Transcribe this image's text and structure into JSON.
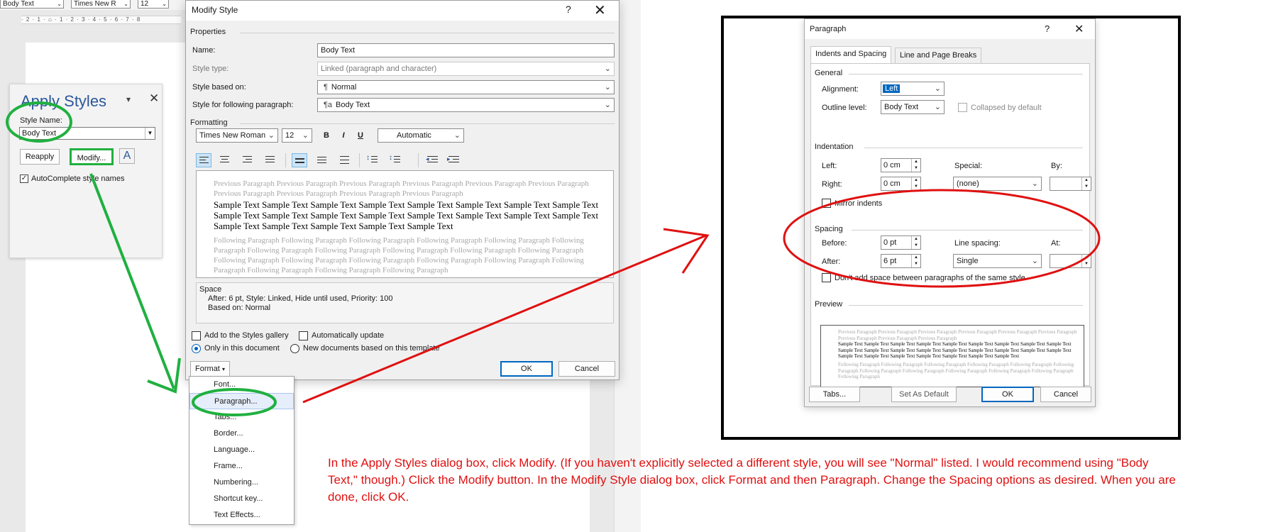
{
  "word": {
    "toolbar": {
      "style_box": "Body Text",
      "font_box": "Times New R",
      "size_box": "12"
    },
    "ruler": "· 2 · 1 · ⌂ · 1 · 2 · 3 · 4 · 5 · 6 · 7 · 8"
  },
  "apply_styles": {
    "title": "Apply Styles",
    "style_name_label": "Style Name:",
    "style_name_value": "Body Text",
    "reapply": "Reapply",
    "modify": "Modify...",
    "styles_icon_glyph": "A",
    "autocomplete_label": "AutoComplete style names",
    "autocomplete_checked": true
  },
  "modify_style": {
    "title": "Modify Style",
    "help": "?",
    "close": "✕",
    "properties_heading": "Properties",
    "name_label": "Name:",
    "name_value": "Body Text",
    "style_type_label": "Style type:",
    "style_type_value": "Linked (paragraph and character)",
    "based_on_label": "Style based on:",
    "based_on_value": "Normal",
    "based_on_glyph": "¶",
    "following_label": "Style for following paragraph:",
    "following_value": "Body Text",
    "following_glyph": "¶a",
    "formatting_heading": "Formatting",
    "font_value": "Times New Roman",
    "size_value": "12",
    "bold": "B",
    "italic": "I",
    "underline": "U",
    "color_value": "Automatic",
    "preview": {
      "previous": "Previous Paragraph Previous Paragraph Previous Paragraph Previous Paragraph Previous Paragraph Previous Paragraph Previous Paragraph Previous Paragraph Previous Paragraph Previous Paragraph",
      "sample": "Sample Text Sample Text Sample Text Sample Text Sample Text Sample Text Sample Text Sample Text Sample Text Sample Text Sample Text Sample Text Sample Text Sample Text Sample Text Sample Text Sample Text Sample Text Sample Text Sample Text Sample Text",
      "following": "Following Paragraph Following Paragraph Following Paragraph Following Paragraph Following Paragraph Following Paragraph Following Paragraph Following Paragraph Following Paragraph Following Paragraph Following Paragraph Following Paragraph Following Paragraph Following Paragraph Following Paragraph Following Paragraph Following Paragraph Following Paragraph Following Paragraph Following Paragraph"
    },
    "description": {
      "heading": "Space",
      "line1": "After:  6 pt, Style: Linked, Hide until used, Priority: 100",
      "line2": "Based on: Normal"
    },
    "add_to_gallery": "Add to the Styles gallery",
    "auto_update": "Automatically update",
    "only_this_doc": "Only in this document",
    "new_docs": "New documents based on this template",
    "format_btn": "Format",
    "ok": "OK",
    "cancel": "Cancel"
  },
  "format_menu": {
    "items": [
      "Font...",
      "Paragraph...",
      "Tabs...",
      "Border...",
      "Language...",
      "Frame...",
      "Numbering...",
      "Shortcut key...",
      "Text Effects..."
    ],
    "highlighted": "Paragraph..."
  },
  "paragraph": {
    "title": "Paragraph",
    "help": "?",
    "close": "✕",
    "tabs": [
      "Indents and Spacing",
      "Line and Page Breaks"
    ],
    "general_heading": "General",
    "alignment_label": "Alignment:",
    "alignment_value": "Left",
    "outline_label": "Outline level:",
    "outline_value": "Body Text",
    "collapsed_label": "Collapsed by default",
    "indentation_heading": "Indentation",
    "left_label": "Left:",
    "left_value": "0 cm",
    "right_label": "Right:",
    "right_value": "0 cm",
    "special_label": "Special:",
    "special_value": "(none)",
    "by_label": "By:",
    "mirror_label": "Mirror indents",
    "spacing_heading": "Spacing",
    "before_label": "Before:",
    "before_value": "0 pt",
    "after_label": "After:",
    "after_value": "6 pt",
    "line_spacing_label": "Line spacing:",
    "line_spacing_value": "Single",
    "at_label": "At:",
    "dont_add_label": "Don't add space between paragraphs of the same style",
    "preview_heading": "Preview",
    "preview": {
      "previous": "Previous Paragraph Previous Paragraph Previous Paragraph Previous Paragraph Previous Paragraph Previous Paragraph Previous Paragraph Previous Paragraph Previous Paragraph",
      "sample": "Sample Text Sample Text Sample Text Sample Text Sample Text Sample Text Sample Text Sample Text Sample Text Sample Text Sample Text Sample Text Sample Text Sample Text Sample Text Sample Text Sample Text Sample Text Sample Text Sample Text Sample Text Sample Text Sample Text Sample Text Sample Text",
      "following": "Following Paragraph Following Paragraph Following Paragraph Following Paragraph Following Paragraph Following Paragraph Following Paragraph Following Paragraph Following Paragraph Following Paragraph Following Paragraph Following Paragraph"
    },
    "tabs_btn": "Tabs...",
    "set_default_btn": "Set As Default",
    "ok": "OK",
    "cancel": "Cancel"
  },
  "instruction": "In the Apply Styles dialog box, click Modify. (If you haven't explicitly selected a different style, you will see \"Normal\" listed. I would recommend using \"Body Text,\" though.) Click the Modify button. In the Modify Style dialog box, click Format and then Paragraph. Change the Spacing options as desired. When you are done, click OK.",
  "colors": {
    "annotation_green": "#20b040",
    "annotation_red": "#e01010",
    "word_blue": "#2b579a",
    "selection_blue": "#0067c0"
  }
}
